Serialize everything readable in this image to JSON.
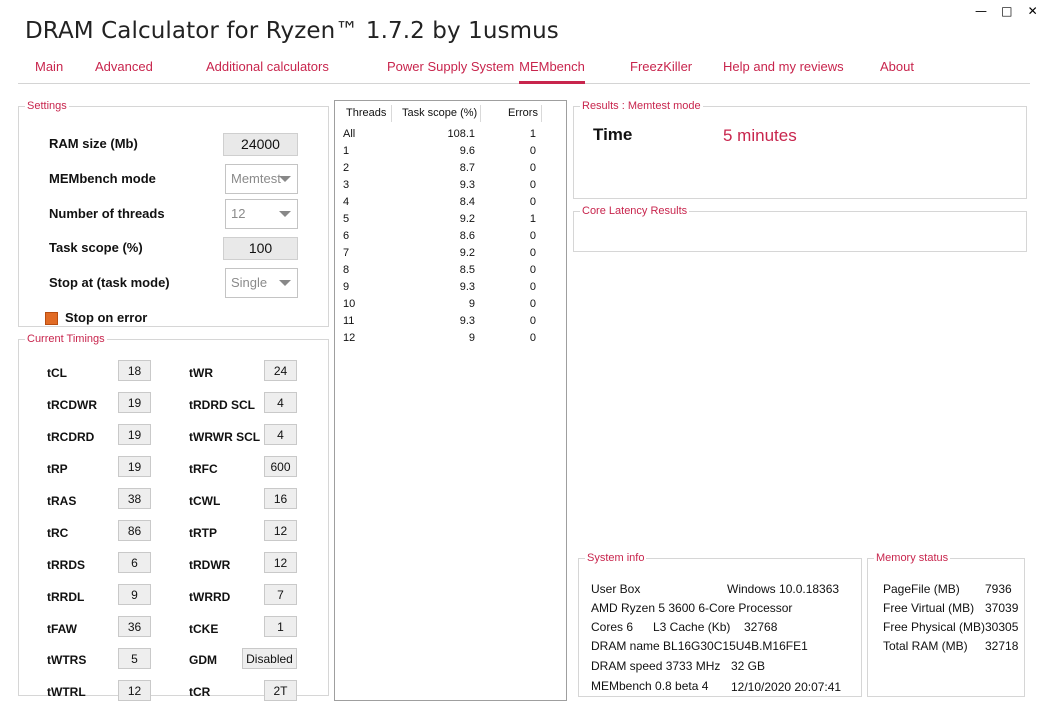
{
  "app": {
    "title": "DRAM Calculator for Ryzen™ 1.7.2 by 1usmus"
  },
  "window_controls": {
    "minimize": "—",
    "maximize": "□",
    "close": "✕"
  },
  "tabs": [
    {
      "label": "Main"
    },
    {
      "label": "Advanced"
    },
    {
      "label": "Additional calculators"
    },
    {
      "label": "Power Supply System"
    },
    {
      "label": "MEMbench"
    },
    {
      "label": "FreezKiller"
    },
    {
      "label": "Help and my reviews"
    },
    {
      "label": "About"
    }
  ],
  "active_tab": "MEMbench",
  "accent_color": "#c8254d",
  "settings": {
    "legend": "Settings",
    "ram_size": {
      "label": "RAM size (Mb)",
      "value": "24000"
    },
    "mode": {
      "label": "MEMbench mode",
      "value": "Memtest"
    },
    "threads": {
      "label": "Number of threads",
      "value": "12"
    },
    "task_scope": {
      "label": "Task scope (%)",
      "value": "100"
    },
    "stop_at": {
      "label": "Stop at (task mode)",
      "value": "Single"
    },
    "stop_on_error": {
      "label": "Stop on error",
      "checked": true
    }
  },
  "timings": {
    "legend": "Current Timings",
    "left": [
      {
        "label": "tCL",
        "value": "18"
      },
      {
        "label": "tRCDWR",
        "value": "19"
      },
      {
        "label": "tRCDRD",
        "value": "19"
      },
      {
        "label": "tRP",
        "value": "19"
      },
      {
        "label": "tRAS",
        "value": "38"
      },
      {
        "label": "tRC",
        "value": "86"
      },
      {
        "label": "tRRDS",
        "value": "6"
      },
      {
        "label": "tRRDL",
        "value": "9"
      },
      {
        "label": "tFAW",
        "value": "36"
      },
      {
        "label": "tWTRS",
        "value": "5"
      },
      {
        "label": "tWTRL",
        "value": "12"
      }
    ],
    "right": [
      {
        "label": "tWR",
        "value": "24"
      },
      {
        "label": "tRDRD SCL",
        "value": "4"
      },
      {
        "label": "tWRWR SCL",
        "value": "4"
      },
      {
        "label": "tRFC",
        "value": "600"
      },
      {
        "label": "tCWL",
        "value": "16"
      },
      {
        "label": "tRTP",
        "value": "12"
      },
      {
        "label": "tRDWR",
        "value": "12"
      },
      {
        "label": "tWRRD",
        "value": "7"
      },
      {
        "label": "tCKE",
        "value": "1"
      },
      {
        "label": "GDM",
        "value": "Disabled"
      },
      {
        "label": "tCR",
        "value": "2T"
      }
    ]
  },
  "thread_table": {
    "headers": [
      "Threads",
      "Task scope (%)",
      "Errors"
    ],
    "rows": [
      [
        "All",
        "108.1",
        "1"
      ],
      [
        "1",
        "9.6",
        "0"
      ],
      [
        "2",
        "8.7",
        "0"
      ],
      [
        "3",
        "9.3",
        "0"
      ],
      [
        "4",
        "8.4",
        "0"
      ],
      [
        "5",
        "9.2",
        "1"
      ],
      [
        "6",
        "8.6",
        "0"
      ],
      [
        "7",
        "9.2",
        "0"
      ],
      [
        "8",
        "8.5",
        "0"
      ],
      [
        "9",
        "9.3",
        "0"
      ],
      [
        "10",
        "9",
        "0"
      ],
      [
        "11",
        "9.3",
        "0"
      ],
      [
        "12",
        "9",
        "0"
      ]
    ]
  },
  "results": {
    "legend": "Results : Memtest mode",
    "time_label": "Time",
    "time_value": "5 minutes"
  },
  "core_latency": {
    "legend": "Core Latency Results"
  },
  "system_info": {
    "legend": "System info",
    "user": "User Box",
    "os": "Windows 10.0.18363",
    "cpu": "AMD Ryzen 5 3600 6-Core Processor",
    "cores": "Cores 6",
    "l3": "L3 Cache (Kb)",
    "l3_value": "32768",
    "dram_name": "DRAM name BL16G30C15U4B.M16FE1",
    "dram_speed": "DRAM speed 3733 MHz",
    "dram_size": "32 GB",
    "membench_version": "MEMbench 0.8 beta 4",
    "timestamp": "12/10/2020 20:07:41"
  },
  "memory_status": {
    "legend": "Memory status",
    "items": [
      {
        "label": "PageFile (MB)",
        "value": "7936"
      },
      {
        "label": "Free Virtual (MB)",
        "value": "37039"
      },
      {
        "label": "Free Physical (MB)",
        "value": "30305"
      },
      {
        "label": "Total RAM (MB)",
        "value": "32718"
      }
    ]
  }
}
